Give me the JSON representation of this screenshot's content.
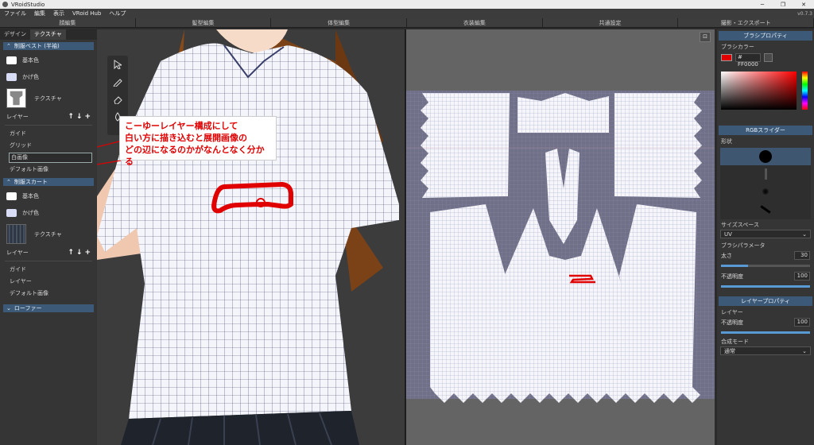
{
  "window": {
    "title": "VRoidStudio"
  },
  "menu": {
    "items": [
      "ファイル",
      "編集",
      "表示",
      "VRoid Hub",
      "ヘルプ"
    ],
    "version": "v0.7.3"
  },
  "modes": [
    "顔編集",
    "髪型編集",
    "体型編集",
    "衣装編集",
    "共通設定",
    "撮影・エクスポート"
  ],
  "left": {
    "tabs": [
      "デザイン",
      "テクスチャ"
    ],
    "sections": [
      {
        "title": "制服ベスト (半袖)",
        "base": "基本色",
        "shade": "かげ色",
        "texture": "テクスチャ",
        "layer_label": "レイヤー",
        "layers": [
          "ガイド",
          "グリッド",
          "白画像",
          "デフォルト画像"
        ],
        "selected": 2
      },
      {
        "title": "制服スカート",
        "base": "基本色",
        "shade": "かげ色",
        "texture": "テクスチャ",
        "layer_label": "レイヤー",
        "layers": [
          "ガイド",
          "レイヤー",
          "デフォルト画像"
        ]
      },
      {
        "title": "ローファー"
      }
    ],
    "layer_buttons": [
      "↑",
      "↓",
      "+"
    ]
  },
  "annotation": {
    "lines": [
      "こーゆーレイヤー構成にして",
      "白い方に描き込むと展開画像の",
      "どの辺になるのかがなんとなく分かる"
    ]
  },
  "right": {
    "brush_props": "ブラシプロパティ",
    "brush_color": "ブラシカラー",
    "hex": "# FF0000",
    "rgb_slider": "RGBスライダー",
    "shape": "形状",
    "size_space": "サイズスペース",
    "size_space_value": "UV",
    "brush_params": "ブラシパラメータ",
    "thickness": "太さ",
    "thickness_value": "30",
    "opacity": "不透明度",
    "opacity_value": "100",
    "layer_props": "レイヤープロパティ",
    "layer": "レイヤー",
    "layer_opacity": "不透明度",
    "layer_opacity_value": "100",
    "blend_mode": "合成モード",
    "blend_value": "通常"
  },
  "colors": {
    "accent": "#3c5a78",
    "brush": "#e00000"
  }
}
